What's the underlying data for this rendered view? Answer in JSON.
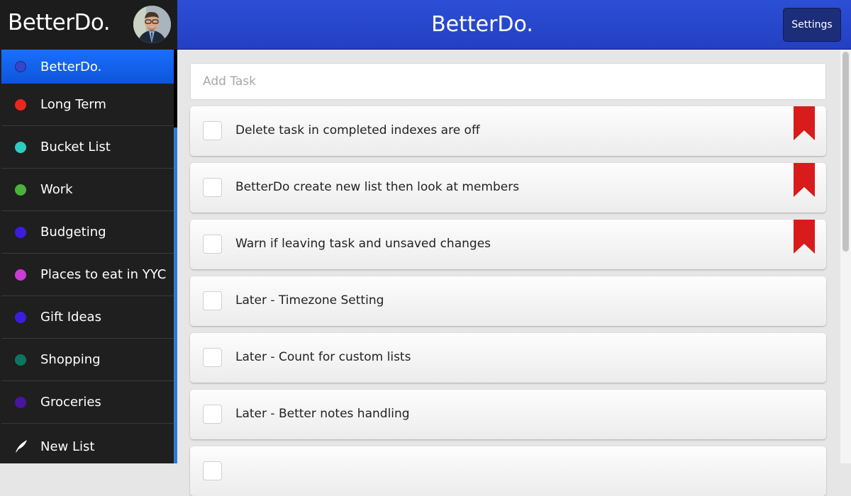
{
  "app": {
    "brand": "BetterDo.",
    "title": "BetterDo."
  },
  "header": {
    "settings_label": "Settings",
    "avatar": "user-avatar"
  },
  "sidebar": {
    "items": [
      {
        "label": "BetterDo.",
        "color": "#3546c8",
        "active": true
      },
      {
        "label": "Long Term",
        "color": "#e8281e"
      },
      {
        "label": "Bucket List",
        "color": "#2ccdc0"
      },
      {
        "label": "Work",
        "color": "#4cb13c"
      },
      {
        "label": "Budgeting",
        "color": "#3b1de0"
      },
      {
        "label": "Places to eat in YYC",
        "color": "#cc3ad8"
      },
      {
        "label": "Gift Ideas",
        "color": "#3b1de0"
      },
      {
        "label": "Shopping",
        "color": "#0c7760"
      },
      {
        "label": "Groceries",
        "color": "#4a14a0"
      }
    ],
    "new_list_label": "New List",
    "new_list_icon": "feather-icon"
  },
  "main": {
    "add_task_placeholder": "Add Task",
    "add_task_value": "",
    "tasks": [
      {
        "text": "Delete task in completed indexes are off",
        "flagged": true,
        "checked": false
      },
      {
        "text": "BetterDo create new list then look at members",
        "flagged": true,
        "checked": false
      },
      {
        "text": "Warn if leaving task and unsaved changes",
        "flagged": true,
        "checked": false
      },
      {
        "text": "Later - Timezone Setting",
        "flagged": false,
        "checked": false
      },
      {
        "text": "Later - Count for custom lists",
        "flagged": false,
        "checked": false
      },
      {
        "text": "Later - Better notes handling",
        "flagged": false,
        "checked": false
      },
      {
        "text": "",
        "flagged": false,
        "checked": false
      }
    ]
  },
  "colors": {
    "accent": "#2c4fd6",
    "active_item": "#1a6fff",
    "bookmark": "#d81b1b"
  }
}
